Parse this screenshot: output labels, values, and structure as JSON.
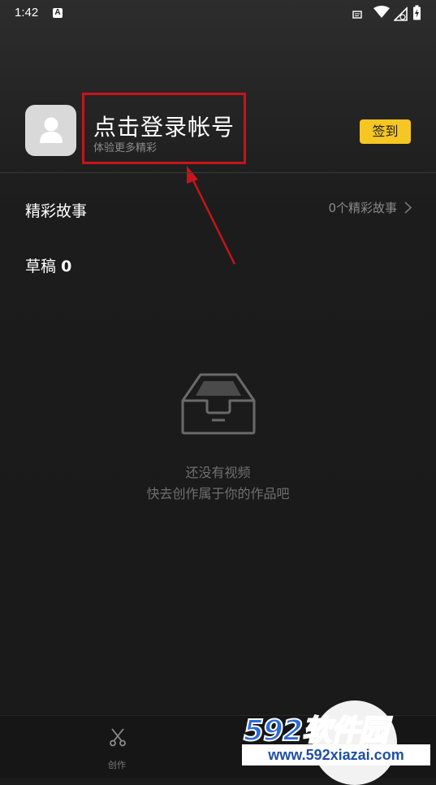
{
  "status_bar": {
    "time": "1:42",
    "icons": [
      "notification-a-icon",
      "message-icon",
      "wifi-icon",
      "signal-icon",
      "battery-icon"
    ]
  },
  "profile": {
    "login_title": "点击登录帐号",
    "login_subtitle": "体验更多精彩",
    "checkin_label": "签到",
    "avatar_icon": "user-placeholder-icon"
  },
  "stories": {
    "label": "精彩故事",
    "count_text": "0个精彩故事"
  },
  "drafts": {
    "label": "草稿",
    "count": "0"
  },
  "empty_state": {
    "icon": "inbox-tray-icon",
    "line1": "还没有视频",
    "line2": "快去创作属于你的作品吧"
  },
  "tab_bar": {
    "create_label": "创作",
    "create_icon": "scissors-icon"
  },
  "watermark": {
    "number": "592",
    "text": "软件园",
    "url": "www.592xiazai.com"
  },
  "colors": {
    "accent": "#f6c623",
    "highlight_box": "#c8141b",
    "annotation_arrow": "#c8141b",
    "background": "#1b1b1b"
  }
}
